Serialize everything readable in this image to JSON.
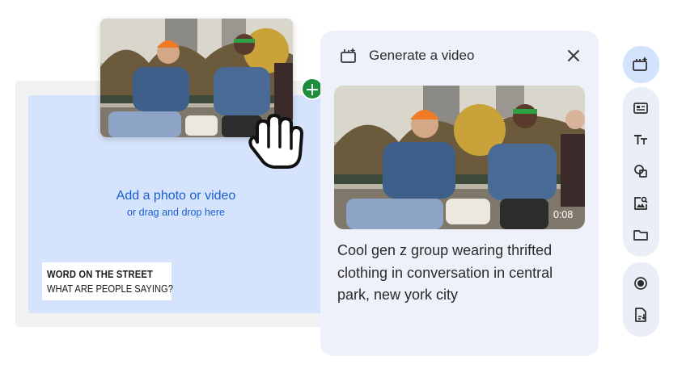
{
  "editor": {
    "dropzone_title": "Add a photo or video",
    "dropzone_subtitle": "or drag and drop here",
    "caption_title": "WORD ON THE STREET",
    "caption_subtitle": "WHAT ARE PEOPLE SAYING?"
  },
  "drag": {
    "badge": "+"
  },
  "panel": {
    "title": "Generate a video",
    "video_duration": "0:08",
    "prompt": "Cool gen z group wearing thrifted clothing in conversation in central park, new york city"
  },
  "toolbar": {
    "items": [
      "generate-video",
      "text-layout",
      "text",
      "shapes",
      "image-search",
      "folder",
      "record",
      "document-download"
    ]
  },
  "colors": {
    "accent_blue": "#1a5fd1",
    "dropzone_bg": "#d6e3fc",
    "panel_bg": "#eef1f9",
    "badge_green": "#1e8e3e"
  }
}
